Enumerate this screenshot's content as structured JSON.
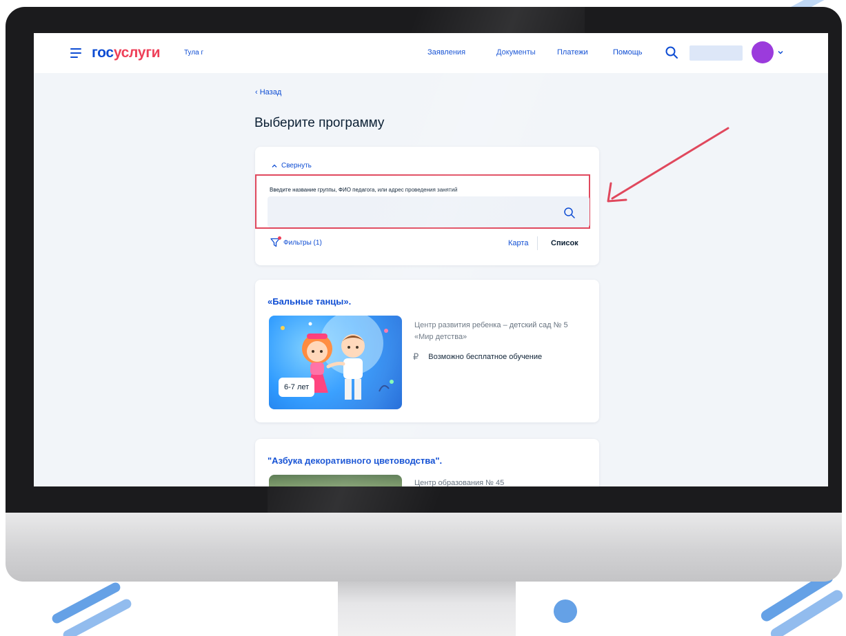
{
  "header": {
    "logo_part1": "гос",
    "logo_part2": "услуги",
    "region": "Тула г",
    "nav": [
      "Заявления",
      "Документы",
      "Платежи",
      "Помощь"
    ]
  },
  "page": {
    "back_label": "Назад",
    "title": "Выберите программу"
  },
  "search": {
    "collapse_label": "Свернуть",
    "label": "Введите название группы, ФИО педагога, или адрес проведения занятий",
    "value": "",
    "filters_label": "Фильтры (1)",
    "view_map": "Карта",
    "view_list": "Список"
  },
  "programs": [
    {
      "title": "«Бальные танцы».",
      "age": "6-7 лет",
      "org": "Центр развития ребенка – детский сад № 5 «Мир детства»",
      "fee": "Возможно бесплатное обучение"
    },
    {
      "title": "\"Азбука декоративного цветоводства\".",
      "org": "Центр образования № 45"
    }
  ],
  "colors": {
    "brand_blue": "#0d4cd3",
    "brand_red": "#ee3f58",
    "highlight_red": "#e0485d",
    "avatar": "#9b3bdc"
  },
  "icons": {
    "menu": "hamburger-icon",
    "search": "search-icon",
    "filter": "filter-icon",
    "currency": "ruble-icon",
    "annotation": "arrow-icon"
  }
}
